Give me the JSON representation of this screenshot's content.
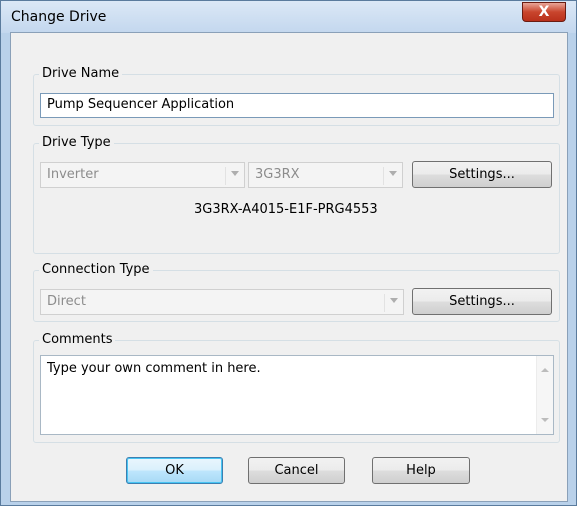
{
  "window": {
    "title": "Change Drive",
    "close_glyph": "X"
  },
  "drive_name": {
    "legend": "Drive Name",
    "value": "Pump Sequencer Application"
  },
  "drive_type": {
    "legend": "Drive Type",
    "type_value": "Inverter",
    "series_value": "3G3RX",
    "settings_label": "Settings...",
    "model_text": "3G3RX-A4015-E1F-PRG4553"
  },
  "connection_type": {
    "legend": "Connection Type",
    "value": "Direct",
    "settings_label": "Settings..."
  },
  "comments": {
    "legend": "Comments",
    "text": "Type your own comment in here."
  },
  "buttons": {
    "ok": "OK",
    "cancel": "Cancel",
    "help": "Help"
  }
}
